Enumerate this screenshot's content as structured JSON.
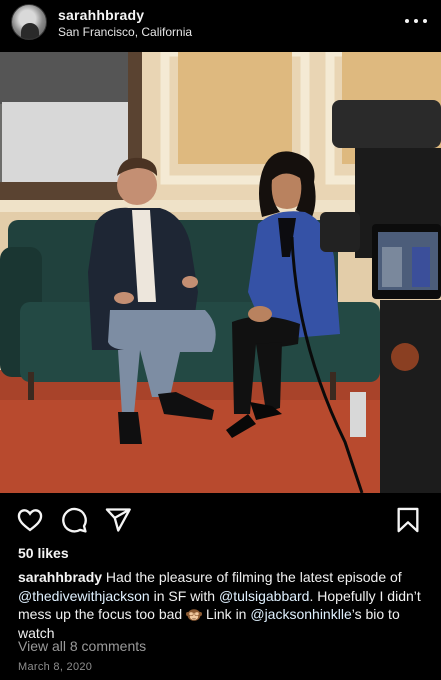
{
  "post": {
    "username": "sarahhbrady",
    "location": "San Francisco, California",
    "likes_text": "50 likes",
    "caption": {
      "user": "sarahhbrady",
      "part1": " Had the pleasure of filming the latest episode of ",
      "mention1": "@thedivewithjackson",
      "part2": " in SF with ",
      "mention2": "@tulsigabbard",
      "part3": ". Hopefully I didn’t mess up the focus too bad ",
      "emoji": "see-no-evil-monkey-emoji",
      "part4": " Link in ",
      "mention3": "@jacksonhinklle",
      "part5": "’s bio to watch"
    },
    "comments_link": "View all 8 comments",
    "date": "March 8, 2020"
  },
  "icons": {
    "more": "more-options-icon",
    "like": "heart-icon",
    "comment": "comment-bubble-icon",
    "share": "paper-plane-icon",
    "save": "bookmark-icon"
  },
  "colors": {
    "background": "#000000",
    "text": "#f5f5f5",
    "mention": "#e0f1ff",
    "muted": "#9a9a9a"
  }
}
